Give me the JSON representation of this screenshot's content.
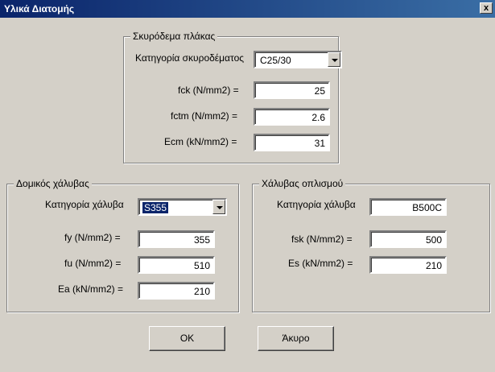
{
  "window": {
    "title": "Υλικά Διατομής",
    "close_glyph": "x"
  },
  "concrete": {
    "legend": "Σκυρόδεμα πλάκας",
    "category_label": "Κατηγορία σκυροδέματος",
    "category_value": "C25/30",
    "fck_label": "fck (N/mm2) =",
    "fck_value": "25",
    "fctm_label": "fctm (N/mm2) =",
    "fctm_value": "2.6",
    "ecm_label": "Ecm (kN/mm2) =",
    "ecm_value": "31"
  },
  "structural_steel": {
    "legend": "Δομικός χάλυβας",
    "category_label": "Κατηγορία χάλυβα",
    "category_value": "S355",
    "fy_label": "fy (N/mm2) =",
    "fy_value": "355",
    "fu_label": "fu (N/mm2) =",
    "fu_value": "510",
    "ea_label": "Ea (kN/mm2) =",
    "ea_value": "210"
  },
  "rebar": {
    "legend": "Χάλυβας οπλισμού",
    "category_label": "Κατηγορία χάλυβα",
    "category_value": "B500C",
    "fsk_label": "fsk (N/mm2) =",
    "fsk_value": "500",
    "es_label": "Es (kN/mm2) =",
    "es_value": "210"
  },
  "buttons": {
    "ok": "OK",
    "cancel": "Άκυρο"
  }
}
